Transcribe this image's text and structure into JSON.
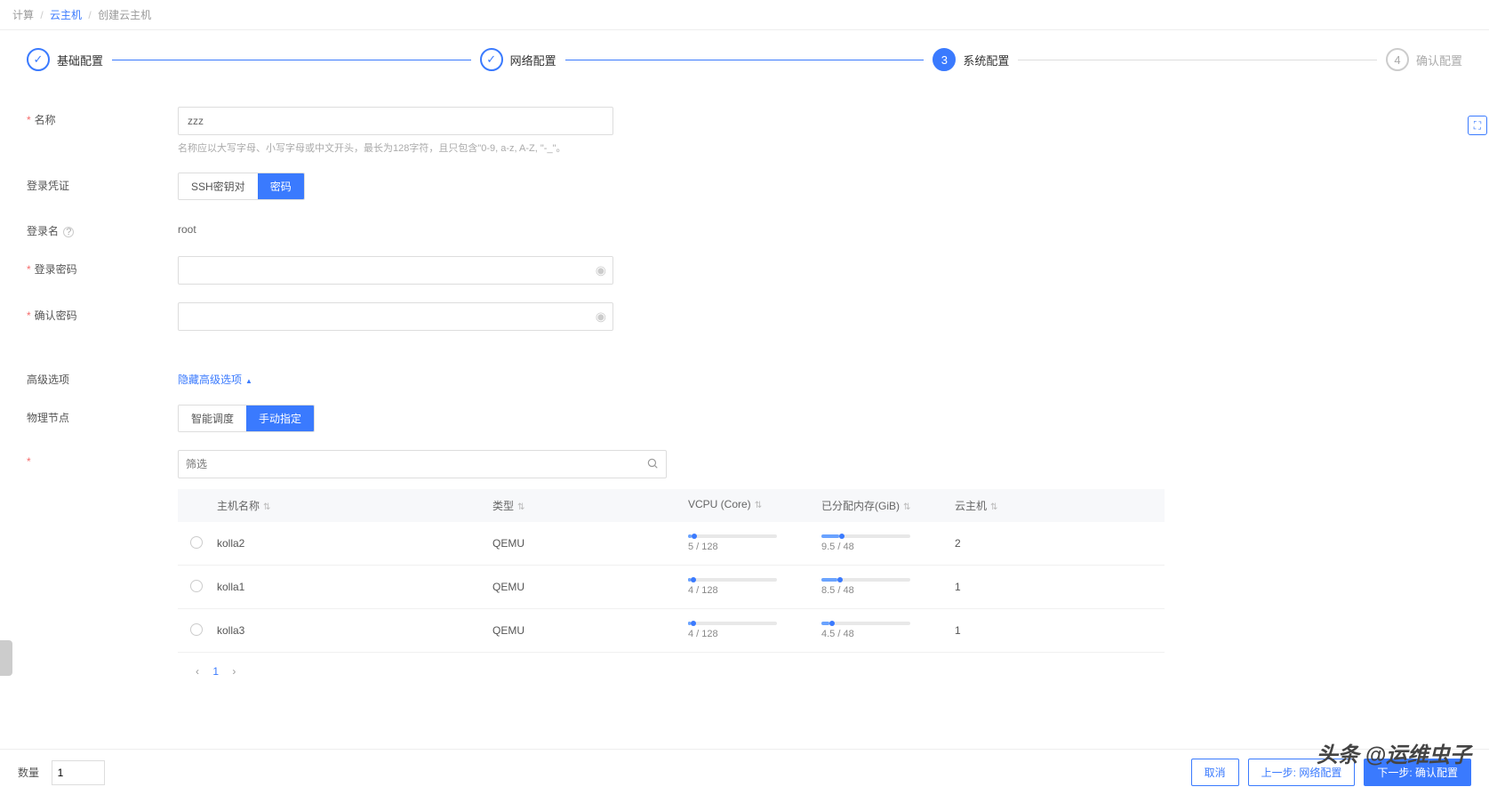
{
  "breadcrumb": {
    "l1": "计算",
    "l2": "云主机",
    "l3": "创建云主机"
  },
  "steps": {
    "s1": "基础配置",
    "s2": "网络配置",
    "s3": "系统配置",
    "s3_num": "3",
    "s4": "确认配置",
    "s4_num": "4"
  },
  "form": {
    "name_label": "名称",
    "name_value": "zzz",
    "name_help": "名称应以大写字母、小写字母或中文开头，最长为128字符，且只包含\"0-9, a-z, A-Z, \"-_\"。",
    "auth_label": "登录凭证",
    "auth_ssh": "SSH密钥对",
    "auth_pwd": "密码",
    "login_label": "登录名",
    "login_help": "?",
    "login_value": "root",
    "pwd_label": "登录密码",
    "confirm_label": "确认密码",
    "adv_label": "高级选项",
    "adv_toggle": "隐藏高级选项",
    "node_label": "物理节点",
    "node_smart": "智能调度",
    "node_manual": "手动指定",
    "filter_placeholder": "筛选"
  },
  "table": {
    "headers": {
      "name": "主机名称",
      "type": "类型",
      "vcpu": "VCPU (Core)",
      "mem": "已分配内存(GiB)",
      "vm": "云主机"
    },
    "rows": [
      {
        "name": "kolla2",
        "type": "QEMU",
        "vcpu": "5 / 128",
        "vcpu_pct": 4,
        "mem": "9.5 / 48",
        "mem_pct": 20,
        "vm": "2"
      },
      {
        "name": "kolla1",
        "type": "QEMU",
        "vcpu": "4 / 128",
        "vcpu_pct": 3,
        "mem": "8.5 / 48",
        "mem_pct": 18,
        "vm": "1"
      },
      {
        "name": "kolla3",
        "type": "QEMU",
        "vcpu": "4 / 128",
        "vcpu_pct": 3,
        "mem": "4.5 / 48",
        "mem_pct": 9,
        "vm": "1"
      }
    ],
    "page_current": "1"
  },
  "footer": {
    "qty_label": "数量",
    "qty_value": "1",
    "cancel": "取消",
    "prev": "上一步: 网络配置",
    "next": "下一步: 确认配置"
  },
  "watermark": "头条 @运维虫子"
}
